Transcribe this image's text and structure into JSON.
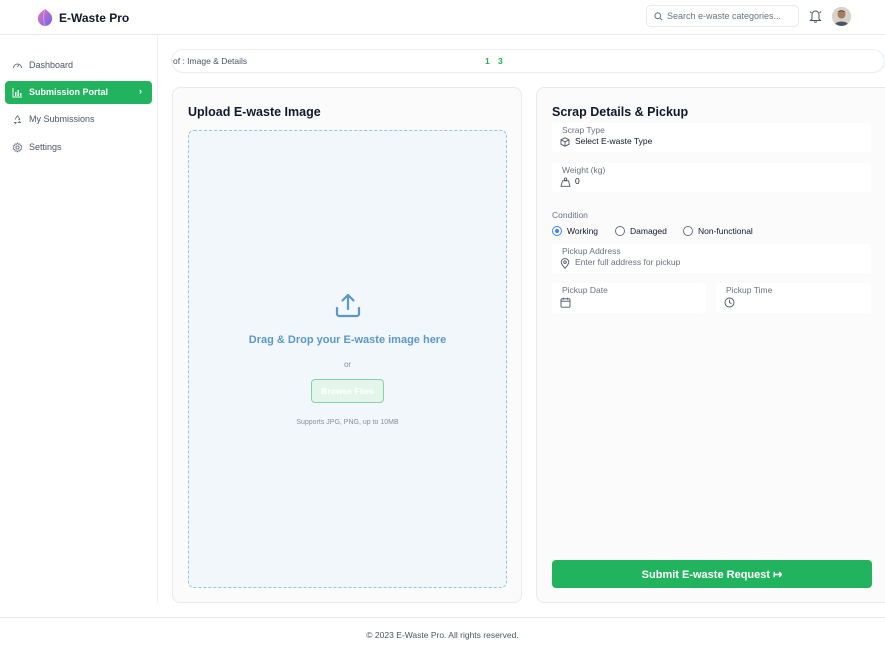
{
  "app": {
    "title": "E-Waste Pro"
  },
  "header": {
    "search_placeholder": "Search e-waste categories...",
    "icons": [
      "search-icon",
      "bell-icon",
      "avatar"
    ]
  },
  "sidebar": {
    "items": [
      {
        "label": "Dashboard",
        "icon": "gauge-icon",
        "active": false
      },
      {
        "label": "Submission Portal",
        "icon": "chart-icon",
        "active": true
      },
      {
        "label": "My Submissions",
        "icon": "recycle-icon",
        "active": false
      },
      {
        "label": "Settings",
        "icon": "gear-icon",
        "active": false
      }
    ],
    "active_chevron": "›"
  },
  "progress": {
    "text": "of : Image & Details",
    "step_a": "1",
    "step_b": "3"
  },
  "upload": {
    "title": "Upload E-waste Image",
    "drop_text": "Drag & Drop your E-waste image here",
    "or_text": "or",
    "browse_label": "Browse Files",
    "note": "Supports JPG, PNG, up to 10MB"
  },
  "form": {
    "title": "Scrap Details & Pickup",
    "scrap_type": {
      "label": "Scrap Type",
      "value": "Select E-waste Type"
    },
    "weight": {
      "label": "Weight (kg)",
      "value": "0"
    },
    "condition": {
      "label": "Condition",
      "options": [
        "Working",
        "Damaged",
        "Non-functional"
      ],
      "selected": "Working"
    },
    "address": {
      "label": "Pickup Address",
      "placeholder": "Enter full address for pickup"
    },
    "date": {
      "label": "Pickup Date"
    },
    "time": {
      "label": "Pickup Time"
    },
    "submit_label": "Submit E-waste Request",
    "submit_icon": "↦"
  },
  "footer": {
    "copyright": "© 2023 E-Waste Pro. All rights reserved."
  },
  "colors": {
    "accent": "#22b35e",
    "dropzone_text": "#5b98c7",
    "dropzone_border": "#93c5e4",
    "radio_selected": "#3b82f6"
  }
}
